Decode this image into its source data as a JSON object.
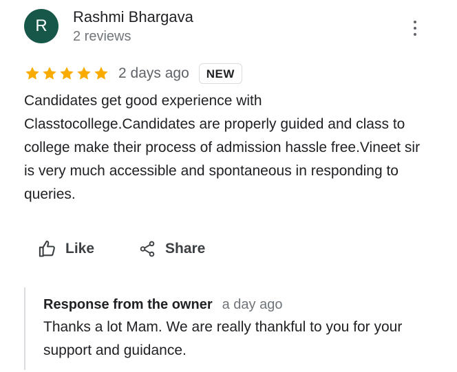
{
  "review": {
    "avatar_letter": "R",
    "author_name": "Rashmi Bhargava",
    "author_meta": "2 reviews",
    "rating": 5,
    "max_rating": 5,
    "date": "2 days ago",
    "badge": "NEW",
    "text": "Candidates get good experience with Classtocollege.Candidates are properly guided and class to college make their process of admission hassle free.Vineet sir is very much accessible and spontaneous in responding to queries.",
    "icons": {
      "more": "more-vert-icon",
      "star": "star-icon",
      "like": "thumb-up-icon",
      "share": "share-icon"
    }
  },
  "actions": {
    "like_label": "Like",
    "share_label": "Share"
  },
  "owner_response": {
    "title": "Response from the owner",
    "date": "a day ago",
    "text": "Thanks a lot Mam. We are really thankful to you for your support and guidance."
  },
  "colors": {
    "avatar": "#17574a",
    "star": "#f9ab00",
    "text": "#202124",
    "muted": "#70757a",
    "border": "#dadce0"
  }
}
